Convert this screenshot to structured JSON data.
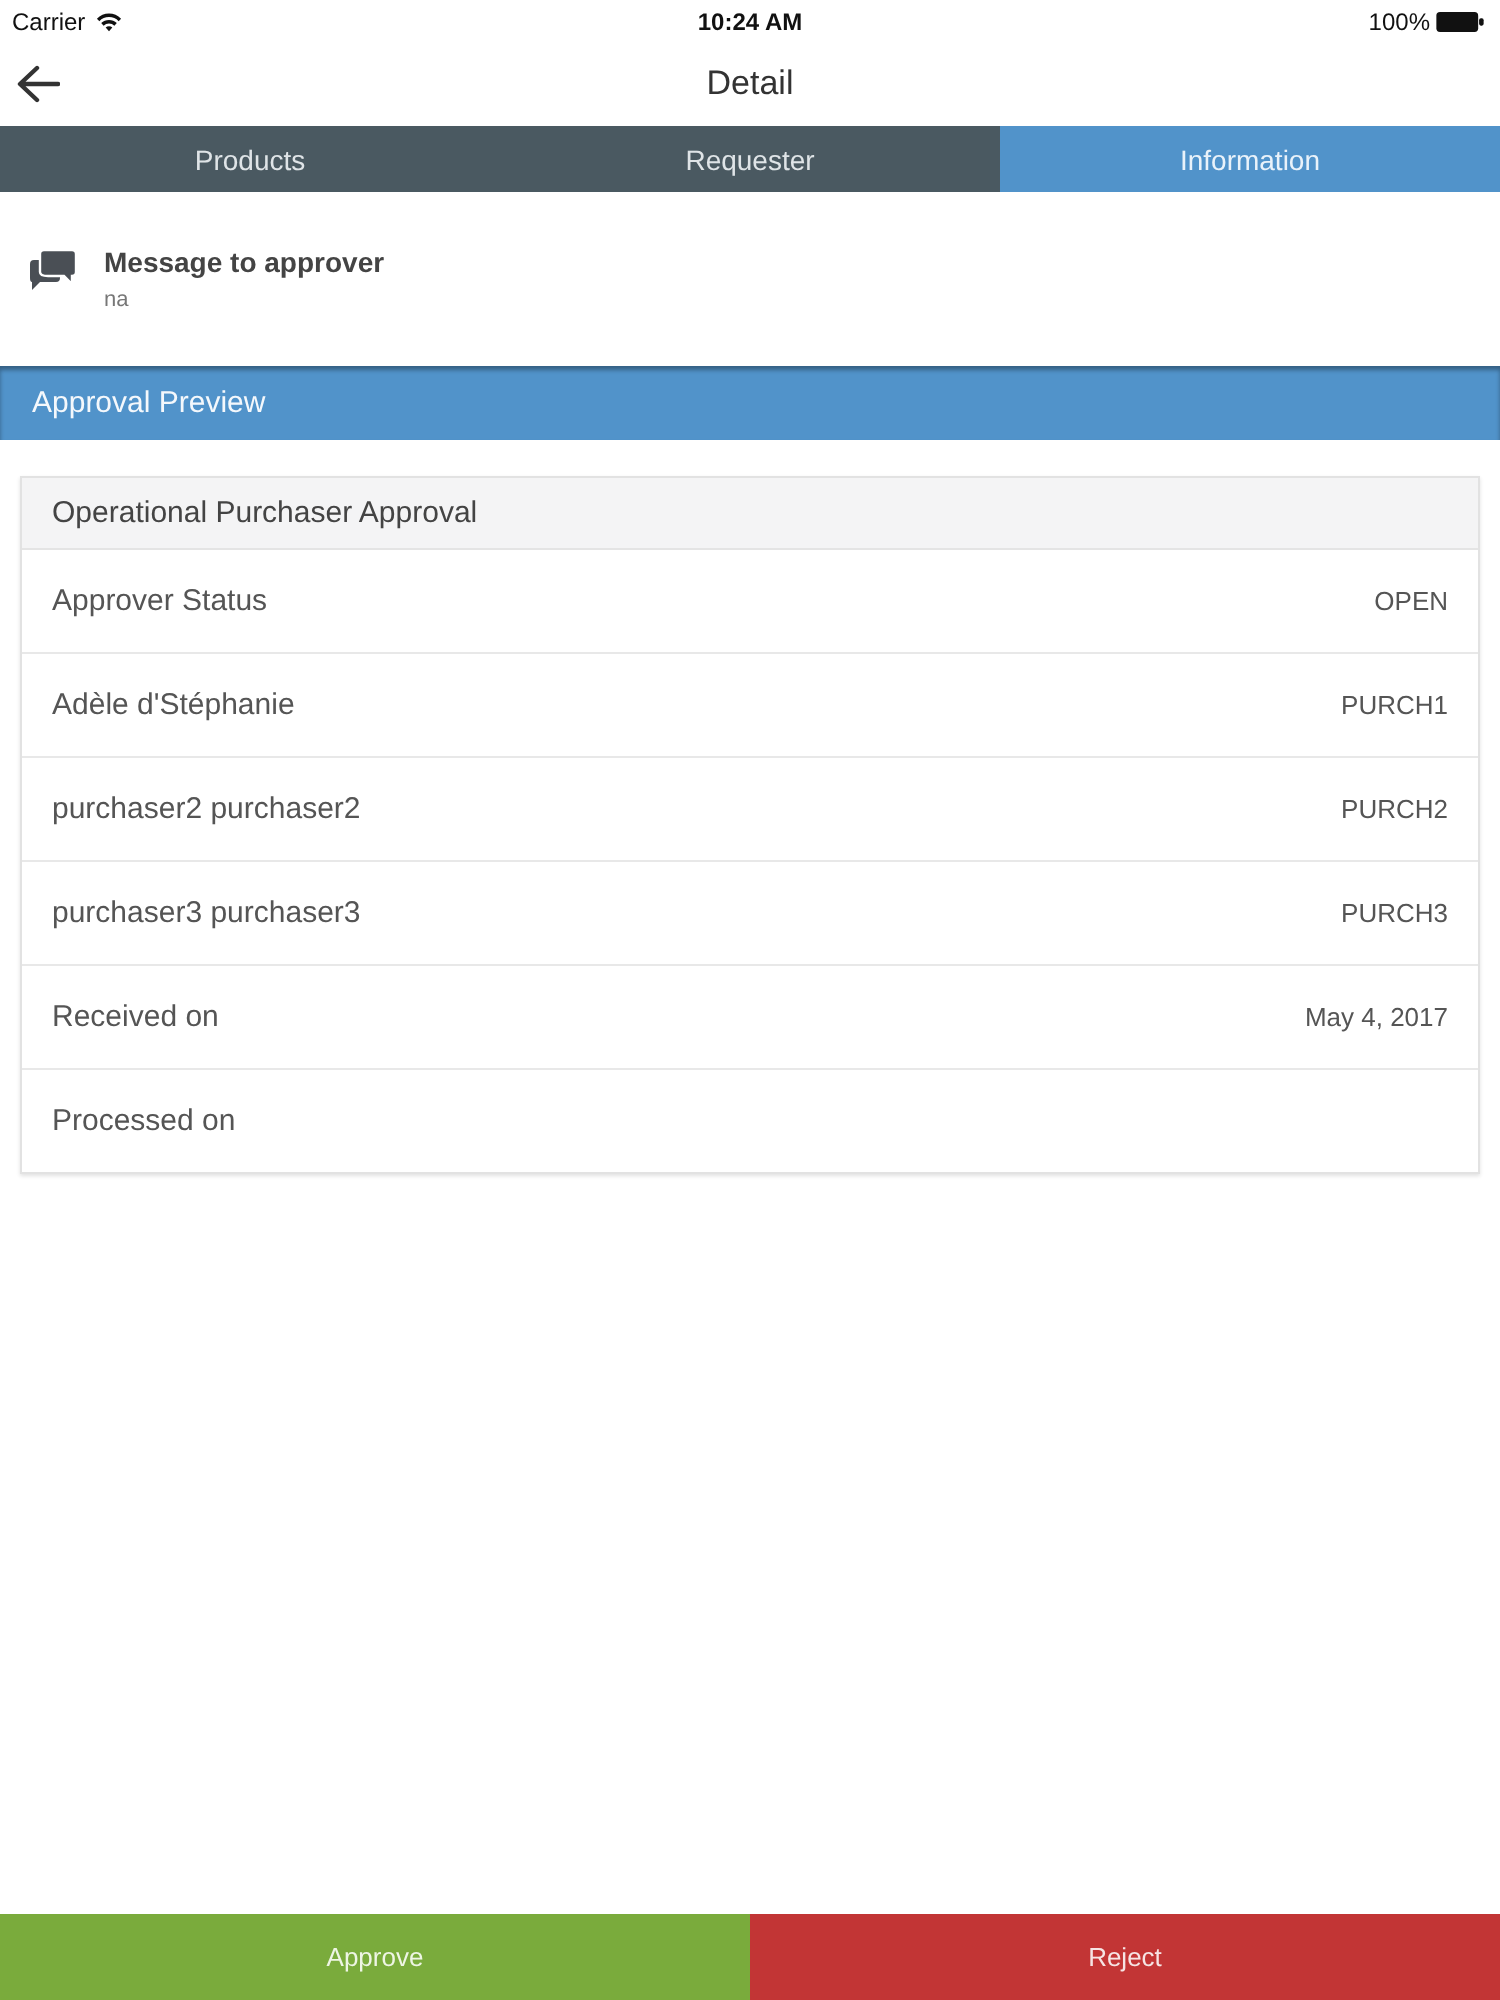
{
  "status_bar": {
    "carrier": "Carrier",
    "time": "10:24 AM",
    "battery": "100%"
  },
  "nav": {
    "title": "Detail"
  },
  "tabs": [
    {
      "label": "Products",
      "selected": false
    },
    {
      "label": "Requester",
      "selected": false
    },
    {
      "label": "Information",
      "selected": true
    }
  ],
  "message": {
    "title": "Message to approver",
    "text": "na"
  },
  "section": {
    "title": "Approval Preview"
  },
  "card": {
    "title": "Operational Purchaser Approval",
    "rows": [
      {
        "label": "Approver Status",
        "value": "OPEN"
      },
      {
        "label": "Adèle d'Stéphanie",
        "value": "PURCH1"
      },
      {
        "label": "purchaser2 purchaser2",
        "value": "PURCH2"
      },
      {
        "label": "purchaser3 purchaser3",
        "value": "PURCH3"
      },
      {
        "label": "Received on",
        "value": "May 4, 2017"
      },
      {
        "label": "Processed on"
      }
    ]
  },
  "actions": [
    {
      "label": "Approve",
      "kind": "approve"
    },
    {
      "label": "Reject",
      "kind": "reject"
    }
  ]
}
